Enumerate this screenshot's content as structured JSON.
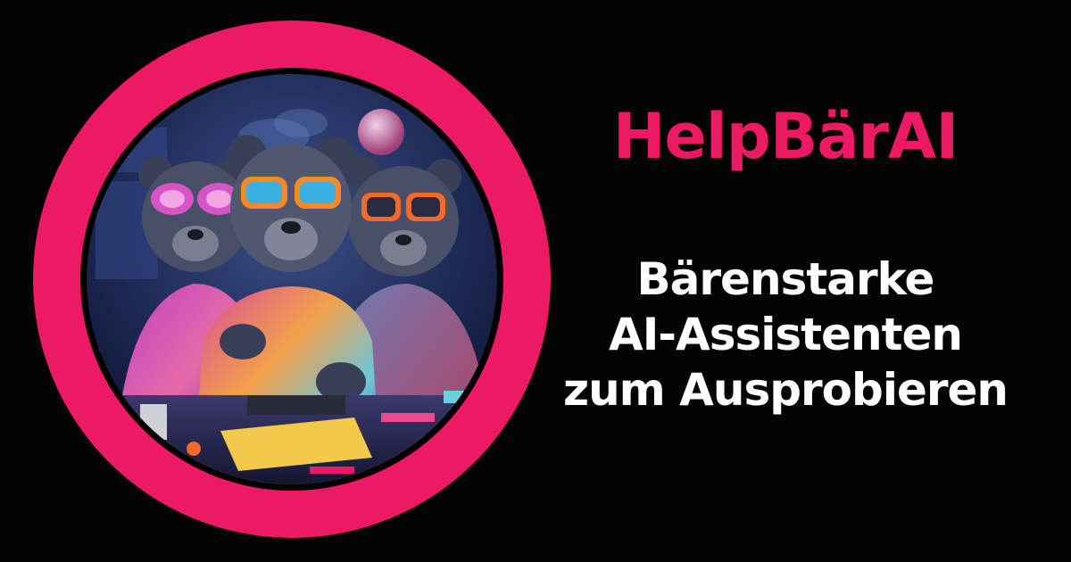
{
  "brand": {
    "title": "HelpBärAI",
    "accent_color": "#ec1a64"
  },
  "tagline": {
    "lines": [
      "Bärenstarke",
      "AI-Assistenten",
      "zum Ausprobieren"
    ],
    "color": "#ffffff"
  },
  "illustration": {
    "subject": "three-bears-in-paint-splattered-jackets-with-sunglasses-icon",
    "frame": "pink-ring"
  }
}
